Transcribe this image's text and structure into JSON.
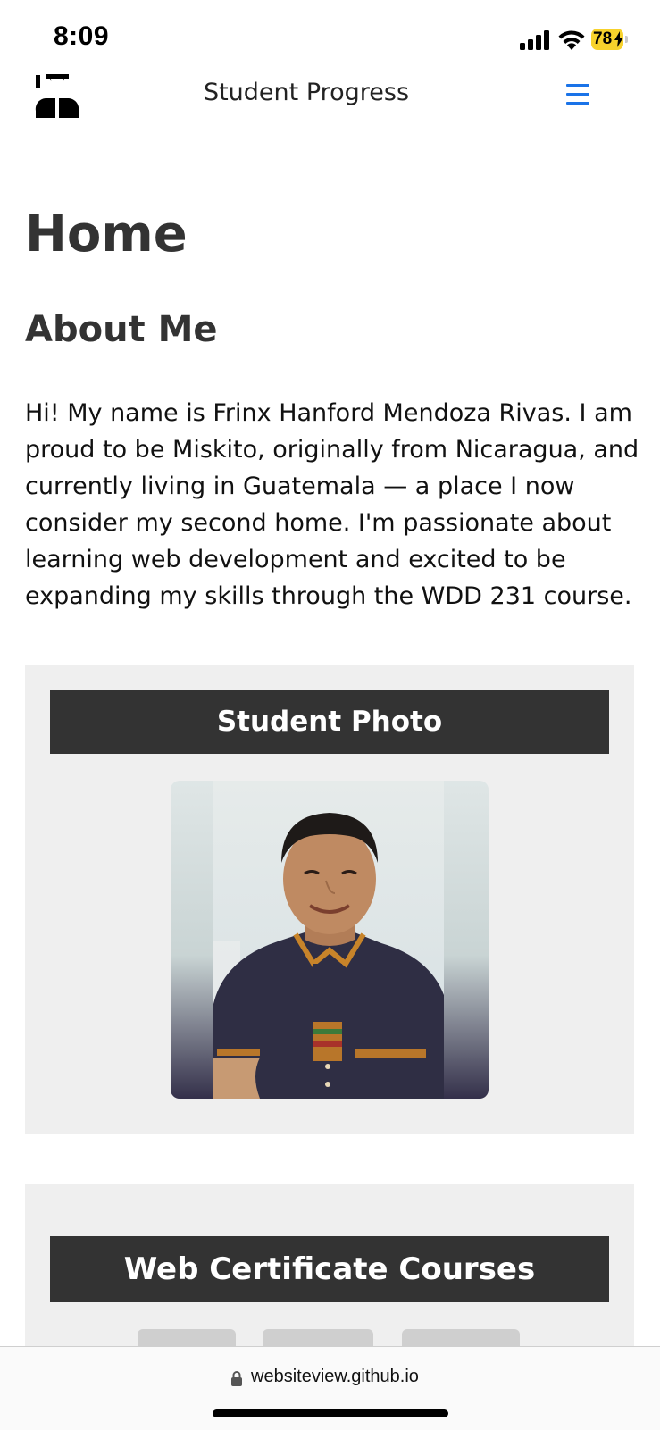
{
  "status_bar": {
    "time": "8:09",
    "battery_level": "78",
    "icons": [
      "signal-icon",
      "wifi-icon",
      "battery-charging-icon"
    ]
  },
  "header": {
    "logo_icon": "student-logo-icon",
    "title": "Student Progress",
    "menu_icon": "hamburger-menu-icon",
    "accent_color": "#1a73e8"
  },
  "main": {
    "page_title": "Home",
    "about_heading": "About Me",
    "about_text": "Hi! My name is Frinx Hanford Mendoza Rivas. I am proud to be Miskito, originally from Nicaragua, and currently living in Guatemala — a place I now consider my second home. I'm passionate about learning web development and excited to be expanding my skills through the WDD 231 course.",
    "photo_card": {
      "heading": "Student Photo"
    },
    "courses_card": {
      "heading": "Web Certificate Courses"
    }
  },
  "browser": {
    "url": "websiteview.github.io"
  },
  "colors": {
    "card_background": "#efefef",
    "card_header_background": "#333333",
    "text": "#333333"
  }
}
